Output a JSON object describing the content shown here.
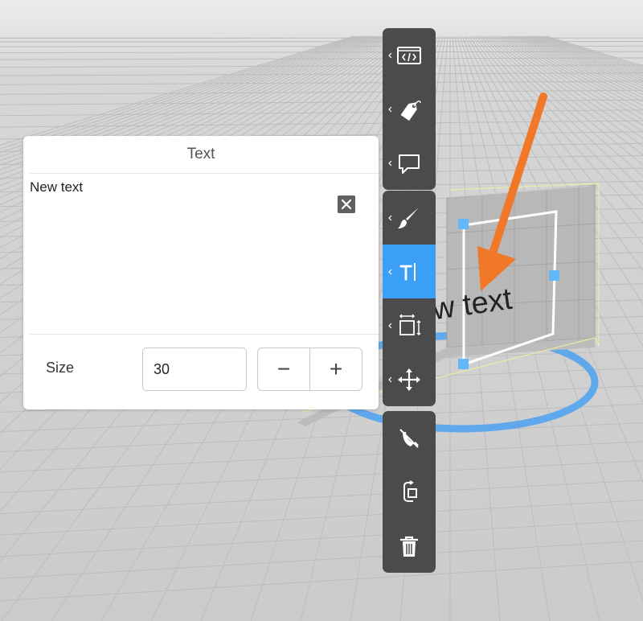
{
  "scene": {
    "viewport_text": "New text"
  },
  "text_panel": {
    "title": "Text",
    "text_value": "New text",
    "clear_icon": "close-icon",
    "size_label": "Size",
    "size_value": "30",
    "decrement_label": "−",
    "increment_label": "+"
  },
  "toolbar": {
    "groups": [
      [
        "code-icon",
        "tag-icon",
        "comment-icon"
      ],
      [
        "brush-icon",
        "text-icon",
        "scale-icon",
        "move-icon"
      ],
      [
        "no-gravity-icon",
        "replace-icon",
        "trash-icon"
      ]
    ],
    "active_tool": "text-icon"
  },
  "colors": {
    "accent": "#3ba0f5",
    "toolbar_bg": "#4b4b4b",
    "arrow": "#f07828",
    "ring": "#5fa8ec",
    "handle": "#64b8f8"
  }
}
